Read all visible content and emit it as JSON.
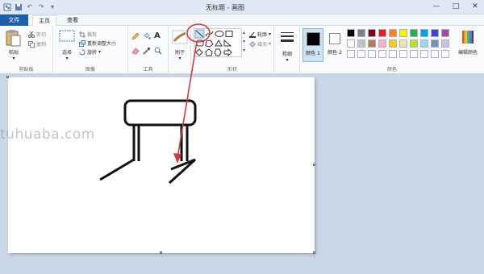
{
  "window": {
    "title": "无标题 - 画图",
    "qat_icons": [
      "paint-app-icon",
      "save-icon",
      "undo-icon",
      "redo-icon",
      "qat-dropdown-icon"
    ],
    "controls": {
      "minimize": "—",
      "maximize": "□",
      "close": "✕"
    }
  },
  "tabs": [
    {
      "label": "文件",
      "active": false
    },
    {
      "label": "主页",
      "active": true
    },
    {
      "label": "查看",
      "active": false
    }
  ],
  "ribbon": {
    "clipboard": {
      "paste_label": "粘贴",
      "cut_label": "剪切",
      "copy_label": "复制",
      "group_label": "剪贴板"
    },
    "image": {
      "select_label": "选择",
      "crop_label": "裁剪",
      "resize_label": "重新调整大小",
      "rotate_label": "旋转",
      "group_label": "图像"
    },
    "tools": {
      "group_label": "工具",
      "items": [
        "pencil-icon",
        "fill-icon",
        "text-icon",
        "eraser-icon",
        "color-picker-icon",
        "magnifier-icon"
      ]
    },
    "brushes": {
      "label": "刷子"
    },
    "shapes": {
      "group_label": "形状",
      "outline_label": "轮廓",
      "fill_label": "填充"
    },
    "size": {
      "label": "粗细"
    },
    "colors": {
      "color1_label": "颜色 1",
      "color2_label": "颜色 2",
      "edit_label": "编辑颜色",
      "group_label": "颜色",
      "color1": "#000000",
      "color2": "#ffffff",
      "palette_row1": [
        "#000000",
        "#7f7f7f",
        "#880015",
        "#ed1c24",
        "#ff7f27",
        "#fff200",
        "#22b14c",
        "#00a2e8",
        "#3f48cc",
        "#a349a4"
      ],
      "palette_row2": [
        "#ffffff",
        "#c3c3c3",
        "#b97a57",
        "#ffaec9",
        "#ffc90e",
        "#efe4b0",
        "#b5e61d",
        "#99d9ea",
        "#7092be",
        "#c8bfe7"
      ]
    }
  },
  "watermark": "tuhuaba.com",
  "annotation": {
    "color": "#d9383d"
  }
}
